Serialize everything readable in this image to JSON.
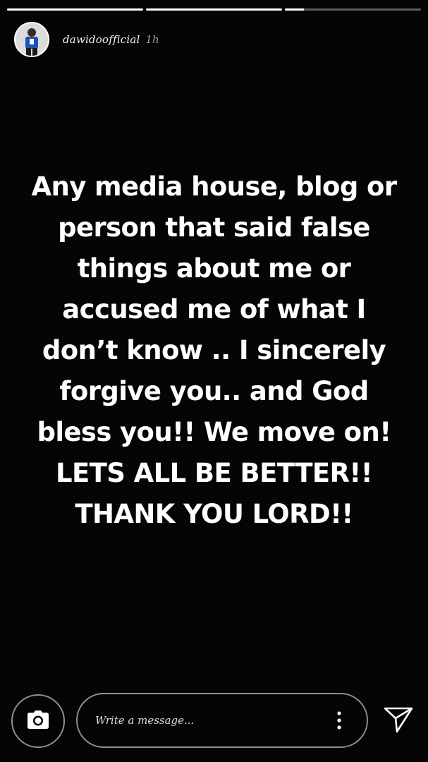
{
  "story": {
    "progress": [
      1.0,
      1.0,
      0.14
    ],
    "username": "dawidoofficial",
    "time_ago": "1h",
    "lines": [
      "Any media house, blog or",
      "person that said false",
      "things about me or",
      "accused me of what I",
      "don’t know .. I sincerely",
      "forgive you.. and God",
      "bless you!! We move on!",
      "LETS ALL BE BETTER!!",
      "THANK YOU LORD!!"
    ]
  },
  "footer": {
    "camera_icon": "camera-icon",
    "message_placeholder": "Write a message...",
    "more_icon": "more-vertical-icon",
    "send_icon": "send-icon"
  }
}
